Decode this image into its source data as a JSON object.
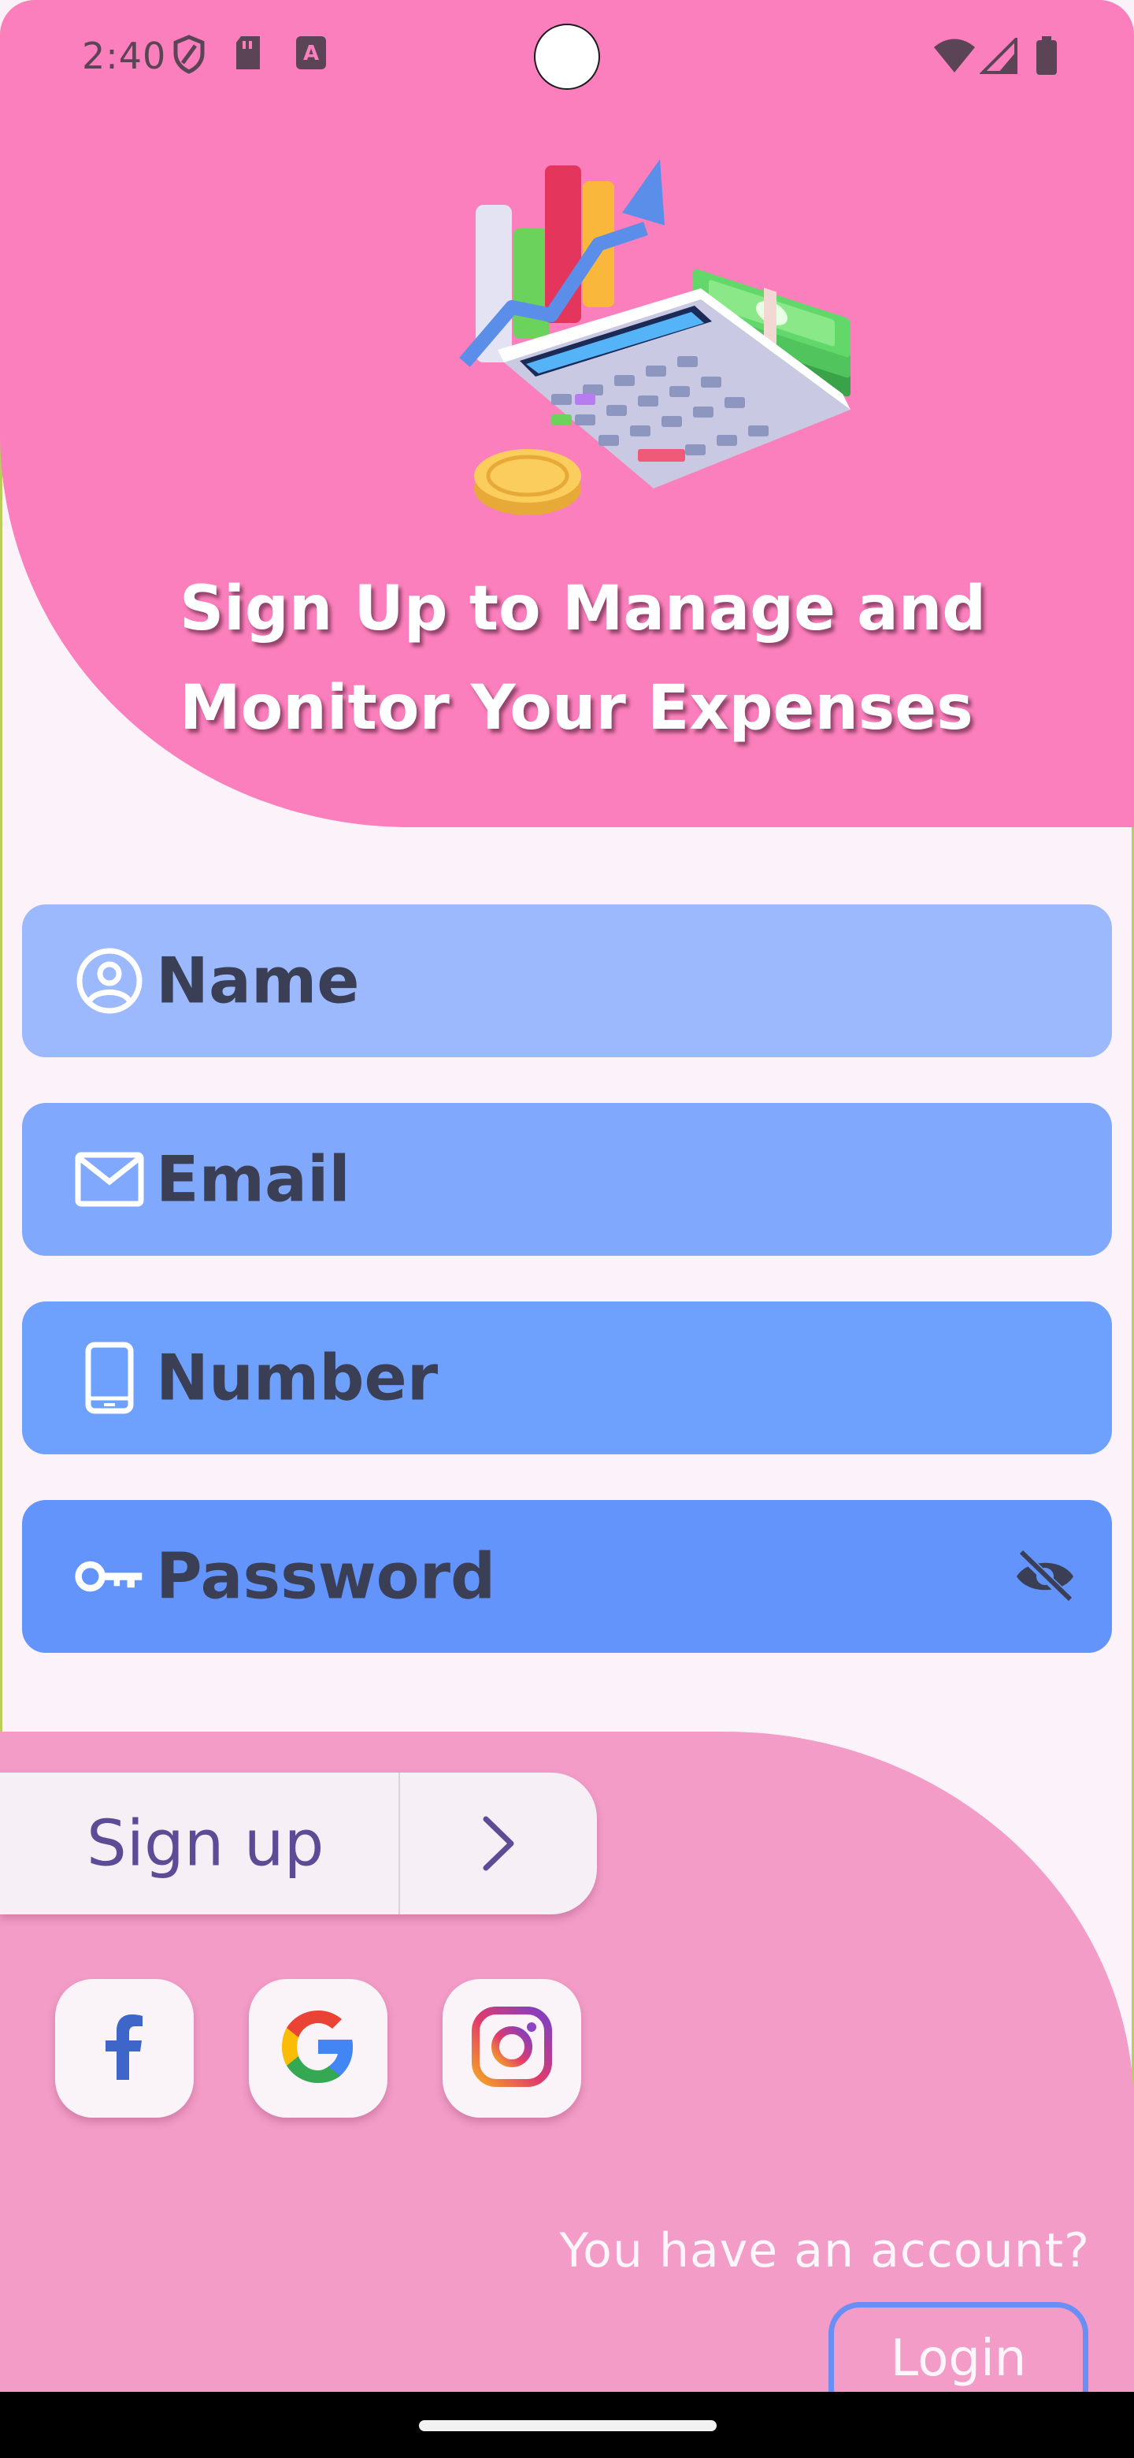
{
  "status_bar": {
    "time": "2:40",
    "icons": [
      "shield-icon",
      "sim-card-icon",
      "keyboard-a-icon",
      "wifi-icon",
      "signal-icon",
      "battery-icon"
    ]
  },
  "header": {
    "title": "Sign Up to Manage and Monitor Your Expenses",
    "illustration": "finance-calculator-illustration"
  },
  "form": {
    "name_label": "Name",
    "email_label": "Email",
    "number_label": "Number",
    "password_label": "Password"
  },
  "actions": {
    "signup_label": "Sign up",
    "have_account": "You have an account?",
    "login_label": "Login"
  },
  "social": [
    "facebook-icon",
    "google-icon",
    "instagram-icon"
  ],
  "colors": {
    "header_pink": "#fb7fbc",
    "bottom_pink": "#f29cc7",
    "field_name": "#9db9fd",
    "field_email": "#80a9fd",
    "field_number": "#6ea0fd",
    "field_password": "#6294fb",
    "accent_purple": "#5e4b96"
  }
}
